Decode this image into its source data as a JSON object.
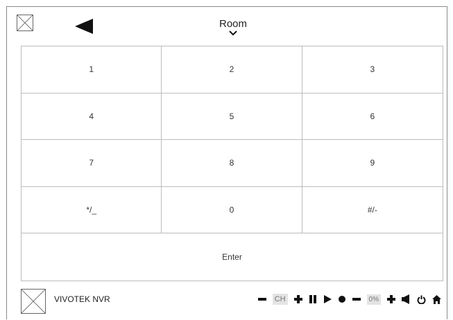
{
  "header": {
    "close_icon": "x-box-icon",
    "back_icon": "back-triangle-icon",
    "room_label": "Room",
    "room_chevron": "chevron-down-icon"
  },
  "keypad": {
    "keys": [
      "1",
      "2",
      "3",
      "4",
      "5",
      "6",
      "7",
      "8",
      "9",
      "*/_",
      "0",
      "#/-"
    ],
    "enter_label": "Enter"
  },
  "footer": {
    "device_icon": "x-box-icon",
    "device_name": "VIVOTEK NVR",
    "channel_label": "CH",
    "volume_label": "0%",
    "icons": [
      "minus-icon",
      "plus-icon",
      "pause-icon",
      "play-icon",
      "record-icon",
      "minus-icon",
      "plus-icon",
      "speaker-icon",
      "power-icon",
      "home-icon"
    ]
  },
  "colors": {
    "border": "#8a8a8a",
    "grid_line": "#bcbcbc",
    "pill_bg": "#e4e4e4",
    "icon": "#111111"
  }
}
